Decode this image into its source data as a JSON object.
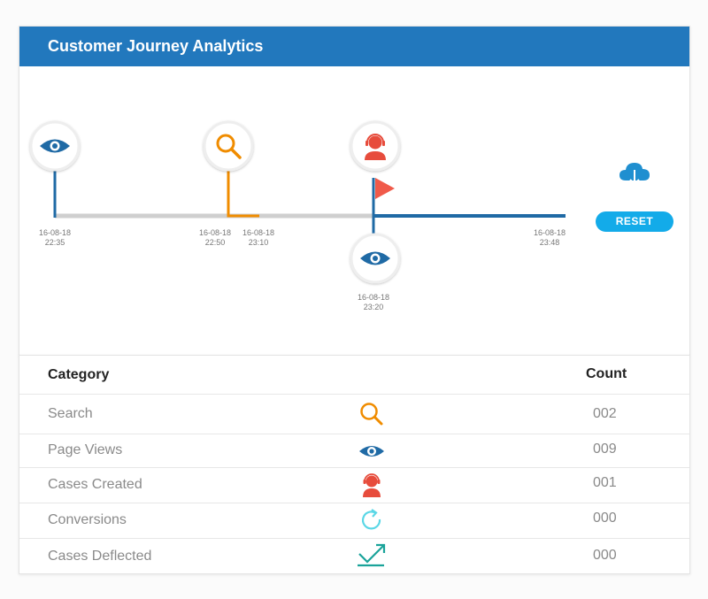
{
  "header": {
    "title": "Customer Journey Analytics"
  },
  "timeline": {
    "events": [
      {
        "icon": "eye-icon",
        "date": "16-08-18",
        "time": "22:35"
      },
      {
        "icon": "search-icon",
        "date": "16-08-18",
        "time": "22:50"
      },
      {
        "icon": "",
        "date": "16-08-18",
        "time": "23:10"
      },
      {
        "icon": "agent-icon",
        "date": "",
        "time": ""
      },
      {
        "icon": "eye-icon",
        "date": "16-08-18",
        "time": "23:20"
      },
      {
        "icon": "",
        "date": "16-08-18",
        "time": "23:48"
      }
    ],
    "colors": {
      "track": "#cfcfcf",
      "blue": "#1f6aa5",
      "orange": "#f08c00",
      "red": "#e74c3c"
    }
  },
  "controls": {
    "reset_label": "RESET",
    "download_icon": "cloud-download-icon"
  },
  "table": {
    "headers": {
      "category": "Category",
      "count": "Count"
    },
    "rows": [
      {
        "label": "Search",
        "icon": "search-icon",
        "count": "002"
      },
      {
        "label": "Page Views",
        "icon": "eye-icon",
        "count": "009"
      },
      {
        "label": "Cases Created",
        "icon": "agent-icon",
        "count": "001"
      },
      {
        "label": "Conversions",
        "icon": "refresh-icon",
        "count": "000"
      },
      {
        "label": "Cases Deflected",
        "icon": "trend-arrow-icon",
        "count": "000"
      }
    ]
  }
}
